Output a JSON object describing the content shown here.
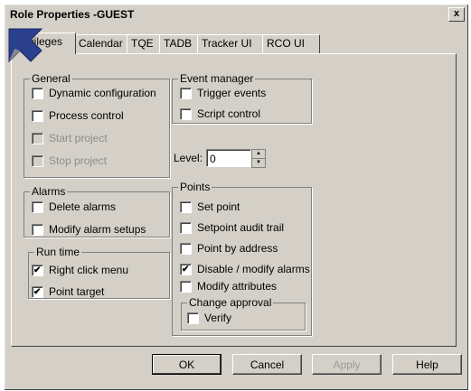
{
  "window": {
    "title": "Role Properties -GUEST",
    "close_label": "x"
  },
  "tabs": [
    "Privileges",
    "Calendar",
    "TQE",
    "TADB",
    "Tracker UI",
    "RCO UI"
  ],
  "groups": {
    "general": {
      "legend": "General",
      "items": [
        {
          "label": "Dynamic configuration",
          "checked": false,
          "disabled": false
        },
        {
          "label": "Process control",
          "checked": false,
          "disabled": false
        },
        {
          "label": "Start project",
          "checked": false,
          "disabled": true
        },
        {
          "label": "Stop project",
          "checked": false,
          "disabled": true
        }
      ]
    },
    "event_manager": {
      "legend": "Event manager",
      "items": [
        {
          "label": "Trigger events",
          "checked": false,
          "disabled": false
        },
        {
          "label": "Script control",
          "checked": false,
          "disabled": false
        }
      ]
    },
    "alarms": {
      "legend": "Alarms",
      "items": [
        {
          "label": "Delete alarms",
          "checked": false,
          "disabled": false
        },
        {
          "label": "Modify alarm setups",
          "checked": false,
          "disabled": false
        }
      ]
    },
    "run_time": {
      "legend": "Run time",
      "items": [
        {
          "label": "Right click menu",
          "checked": true,
          "disabled": false
        },
        {
          "label": "Point target",
          "checked": true,
          "disabled": false
        }
      ]
    },
    "points": {
      "legend": "Points",
      "items": [
        {
          "label": "Set point",
          "checked": false,
          "disabled": false
        },
        {
          "label": "Setpoint audit trail",
          "checked": false,
          "disabled": false
        },
        {
          "label": "Point by address",
          "checked": false,
          "disabled": false
        },
        {
          "label": "Disable / modify alarms",
          "checked": true,
          "disabled": false
        },
        {
          "label": "Modify attributes",
          "checked": false,
          "disabled": false
        }
      ]
    },
    "change_approval": {
      "legend": "Change approval",
      "items": [
        {
          "label": "Verify",
          "checked": false,
          "disabled": false
        }
      ]
    }
  },
  "level": {
    "label": "Level:",
    "value": "0"
  },
  "buttons": {
    "ok": "OK",
    "cancel": "Cancel",
    "apply": "Apply",
    "help": "Help"
  }
}
